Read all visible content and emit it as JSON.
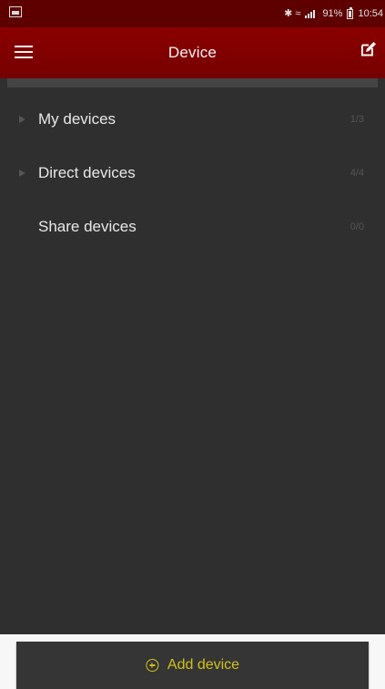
{
  "status_bar": {
    "icon_left": "image-icon",
    "status_symbols": "✱ ≈",
    "battery_percent": "91%",
    "time": "10:54"
  },
  "app_bar": {
    "title": "Device",
    "menu_icon": "menu-icon",
    "edit_icon": "edit-icon"
  },
  "devices": [
    {
      "label": "My devices",
      "count": "1/3",
      "arrow_icon": "chevron-right-icon"
    },
    {
      "label": "Direct devices",
      "count": "4/4",
      "arrow_icon": "chevron-right-icon"
    },
    {
      "label": "Share devices",
      "count": "0/0"
    }
  ],
  "bottom_action": {
    "label": "Add device",
    "icon": "add-circle-icon"
  },
  "colors": {
    "status_bar": "#5e0000",
    "app_bar": "#8b0000",
    "content_background": "#2f2f2f",
    "accent": "#d1c11a",
    "muted_text": "#555555"
  }
}
